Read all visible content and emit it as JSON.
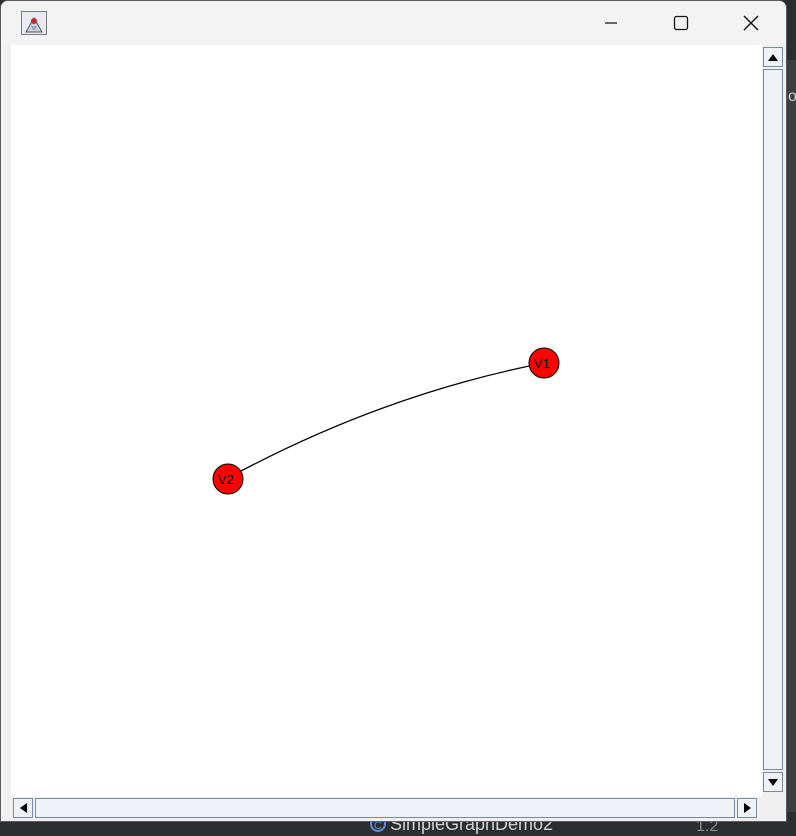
{
  "window": {
    "title": "",
    "controls": {
      "minimize": "minimize",
      "maximize": "maximize",
      "close": "close"
    }
  },
  "graph": {
    "vertices": [
      {
        "id": "v1",
        "label": "V1",
        "color": "#ff0000"
      },
      {
        "id": "v2",
        "label": "V2",
        "color": "#ff0000"
      }
    ],
    "edges": [
      {
        "from": "v1",
        "to": "v2",
        "curved": true
      }
    ],
    "edge_color": "#000000"
  },
  "background": {
    "tab_label": "SimpleGraphDemo2",
    "right_fragment": "ol",
    "bottom_right_fragment": "1.2"
  }
}
